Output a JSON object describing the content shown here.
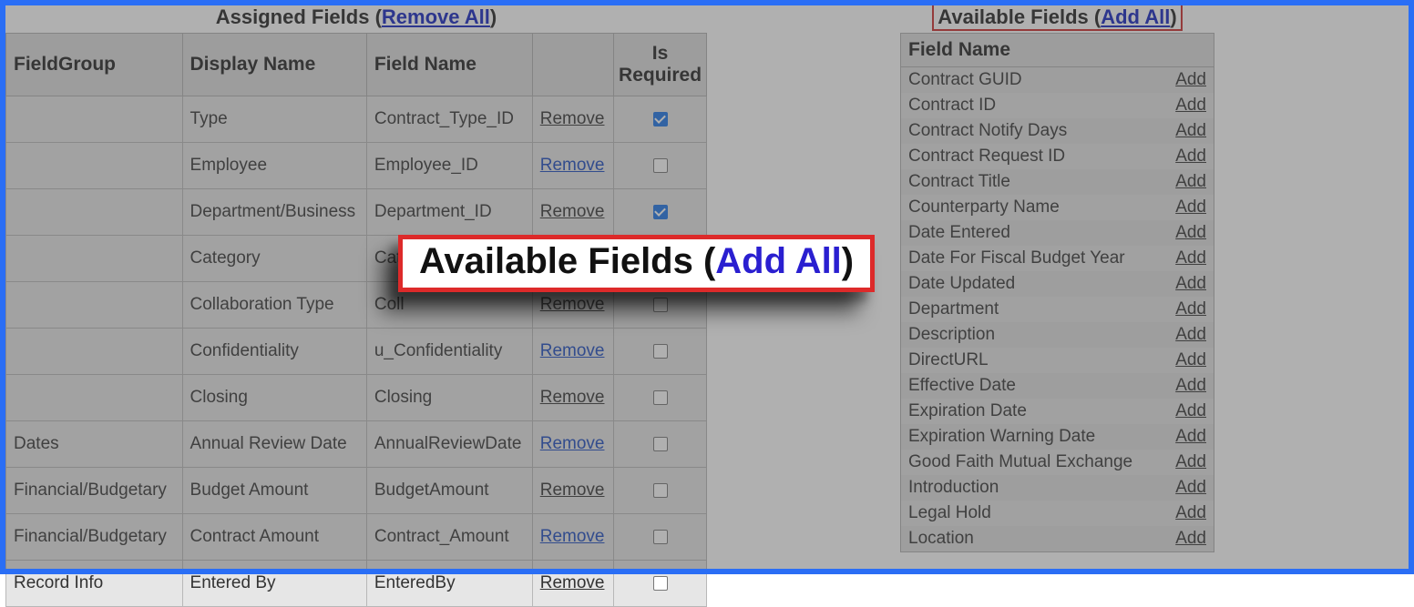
{
  "assigned": {
    "heading_prefix": "Assigned Fields (",
    "heading_link": "Remove All",
    "heading_suffix": ")",
    "headers": {
      "field_group": "FieldGroup",
      "display_name": "Display Name",
      "field_name": "Field Name",
      "is_required": "Is Required"
    },
    "remove_label": "Remove",
    "rows": [
      {
        "group": "",
        "display": "Type",
        "field": "Contract_Type_ID",
        "remove_blue": false,
        "required": true
      },
      {
        "group": "",
        "display": "Employee",
        "field": "Employee_ID",
        "remove_blue": true,
        "required": false
      },
      {
        "group": "",
        "display": "Department/Business",
        "field": "Department_ID",
        "remove_blue": false,
        "required": true
      },
      {
        "group": "",
        "display": "Category",
        "field": "Category_ID",
        "remove_blue": false,
        "required": false
      },
      {
        "group": "",
        "display": "Collaboration Type",
        "field": "Coll",
        "remove_blue": false,
        "required": false
      },
      {
        "group": "",
        "display": "Confidentiality",
        "field": "u_Confidentiality",
        "remove_blue": true,
        "required": false
      },
      {
        "group": "",
        "display": "Closing",
        "field": "Closing",
        "remove_blue": false,
        "required": false
      },
      {
        "group": "Dates",
        "display": "Annual Review Date",
        "field": "AnnualReviewDate",
        "remove_blue": true,
        "required": false
      },
      {
        "group": "Financial/Budgetary",
        "display": "Budget Amount",
        "field": "BudgetAmount",
        "remove_blue": false,
        "required": false
      },
      {
        "group": "Financial/Budgetary",
        "display": "Contract Amount",
        "field": "Contract_Amount",
        "remove_blue": true,
        "required": false
      },
      {
        "group": "Record Info",
        "display": "Entered By",
        "field": "EnteredBy",
        "remove_blue": false,
        "required": false
      }
    ]
  },
  "available": {
    "heading_prefix": "Available Fields (",
    "heading_link": "Add All",
    "heading_suffix": ")",
    "header": "Field Name",
    "add_label": "Add",
    "rows": [
      "Contract GUID",
      "Contract ID",
      "Contract Notify Days",
      "Contract Request ID",
      "Contract Title",
      "Counterparty Name",
      "Date Entered",
      "Date For Fiscal Budget Year",
      "Date Updated",
      "Department",
      "Description",
      "DirectURL",
      "Effective Date",
      "Expiration Date",
      "Expiration Warning Date",
      "Good Faith Mutual Exchange",
      "Introduction",
      "Legal Hold",
      "Location"
    ]
  },
  "callout": {
    "prefix": "Available Fields (",
    "link": "Add All",
    "suffix": ")"
  }
}
